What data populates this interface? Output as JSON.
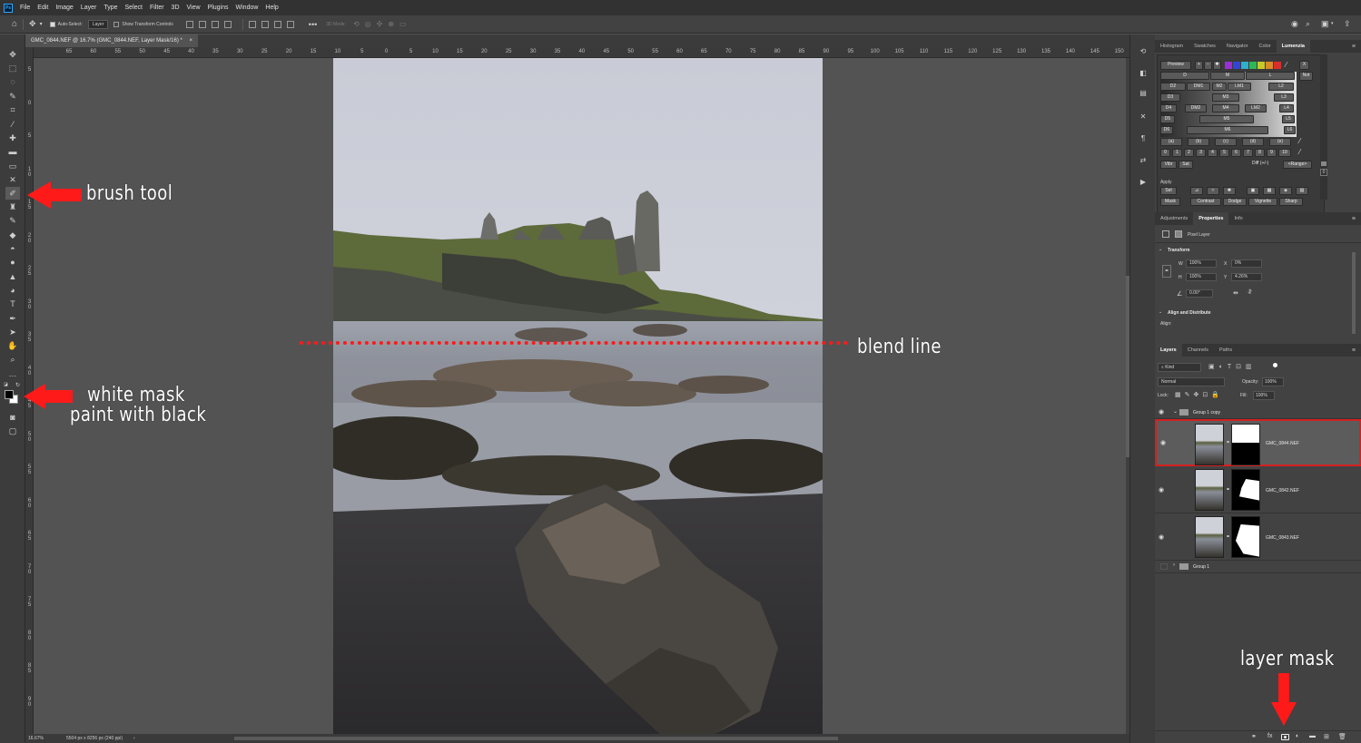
{
  "menu": [
    "File",
    "Edit",
    "Image",
    "Layer",
    "Type",
    "Select",
    "Filter",
    "3D",
    "View",
    "Plugins",
    "Window",
    "Help"
  ],
  "options": {
    "auto_select_label": "Auto-Select:",
    "auto_select_value": "Layer",
    "show_transform_controls": "Show Transform Controls",
    "three_d_mode": "3D Mode:"
  },
  "document": {
    "tab_title": "GMC_0844.NEF @ 16.7% (GMC_0844.NEF, Layer Mask/16) *",
    "zoom": "16.67%",
    "dimensions": "5504 px x 8256 px (240 ppi)"
  },
  "ruler_top": [
    "65",
    "60",
    "55",
    "50",
    "45",
    "40",
    "35",
    "30",
    "25",
    "20",
    "15",
    "10",
    "5",
    "0",
    "5",
    "10",
    "15",
    "20",
    "25",
    "30",
    "35",
    "40",
    "45",
    "50",
    "55",
    "60",
    "65",
    "70",
    "75",
    "80",
    "85",
    "90",
    "95",
    "100",
    "105",
    "110",
    "115",
    "120",
    "125",
    "130",
    "135",
    "140",
    "145",
    "150",
    "155",
    "1"
  ],
  "ruler_left": [
    "5",
    "0",
    "5",
    "1 0",
    "1 5",
    "2 0",
    "2 5",
    "3 0",
    "3 5",
    "4 0",
    "4 5",
    "5 0",
    "5 5",
    "6 0",
    "6 5",
    "7 0",
    "7 5",
    "8 0",
    "8 5",
    "9 0"
  ],
  "panels": {
    "top_tabs": [
      "Histogram",
      "Swatches",
      "Navigator",
      "Color",
      "Lumenzia"
    ],
    "top_active": "Lumenzia",
    "mid_tabs": [
      "Adjustments",
      "Properties",
      "Info"
    ],
    "mid_active": "Properties",
    "layers_tabs": [
      "Layers",
      "Channels",
      "Paths"
    ],
    "layers_active": "Layers"
  },
  "lumenzia": {
    "preview": "Preview",
    "x_label": "X",
    "not_label": "Not",
    "rows": [
      [
        "D",
        "M",
        "L"
      ],
      [
        "D2",
        "DM1",
        "M2",
        "LM1",
        "L2"
      ],
      [
        "D3",
        "M3",
        "L3"
      ],
      [
        "D4",
        "DM2",
        "M4",
        "LM2",
        "L4"
      ],
      [
        "D5",
        "M5",
        "L5"
      ],
      [
        "D6",
        "M6",
        "L6"
      ]
    ],
    "zone_row": [
      "(a)",
      "(b)",
      "(c)",
      "(d)",
      "(e)"
    ],
    "num_row": [
      "0",
      "1",
      "2",
      "3",
      "4",
      "5",
      "6",
      "7",
      "8",
      "9",
      "10"
    ],
    "vibr": "Vibr",
    "sat": "Sat",
    "diff": "Diff (+/-)",
    "range": "<Range>",
    "apply": "Apply",
    "sel": "Sel",
    "mask": "Mask",
    "contrast": "Contrast",
    "dodge": "Dodge",
    "vignette": "Vignette",
    "sharp": "Sharp"
  },
  "properties": {
    "pixel_layer": "Pixel Layer",
    "transform": "Transform",
    "w_label": "W",
    "w_value": "100%",
    "h_label": "H",
    "h_value": "100%",
    "x_label": "X",
    "x_value": "0%",
    "y_label": "Y",
    "y_value": "4.26%",
    "angle_value": "0.00°",
    "align_distribute": "Align and Distribute",
    "align_label": "Align:"
  },
  "layers": {
    "kind": "Kind",
    "blend_mode": "Normal",
    "opacity_label": "Opacity:",
    "opacity_value": "100%",
    "lock_label": "Lock:",
    "fill_label": "Fill:",
    "fill_value": "100%",
    "group_copy": "Group 1 copy",
    "items": [
      {
        "name": "GMC_0844.NEF"
      },
      {
        "name": "GMC_0842.NEF"
      },
      {
        "name": "GMC_0843.NEF"
      }
    ],
    "group1": "Group 1"
  },
  "annotations": {
    "brush_tool": "brush tool",
    "white_mask": "white mask",
    "paint_with_black": "paint with black",
    "blend_line": "blend line",
    "layer_mask": "layer mask"
  },
  "colors": {
    "annotation_red": "#ff1a1a",
    "highlight_red": "#d42020",
    "ui_dark": "#323232",
    "ui_panel": "#424242",
    "canvas_gray": "#535353"
  }
}
